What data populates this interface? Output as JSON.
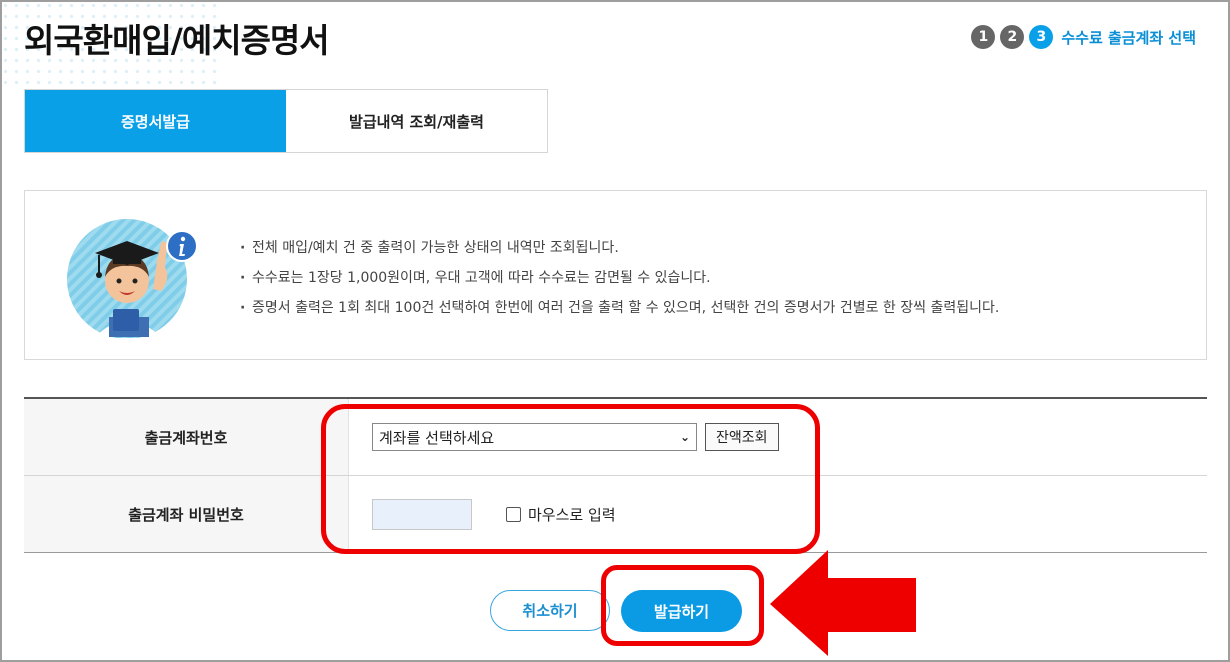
{
  "page": {
    "title": "외국환매입/예치증명서"
  },
  "steps": {
    "items": [
      "1",
      "2",
      "3"
    ],
    "current_label": "수수료 출금계좌 선택"
  },
  "tabs": [
    {
      "label": "증명서발급",
      "active": true
    },
    {
      "label": "발급내역 조회/재출력",
      "active": false
    }
  ],
  "notice": {
    "icon": "info-icon",
    "items": [
      "전체 매입/예치 건 중 출력이 가능한 상태의 내역만 조회됩니다.",
      "수수료는 1장당 1,000원이며, 우대 고객에 따라 수수료는 감면될 수 있습니다.",
      "증명서 출력은 1회 최대 100건 선택하여 한번에 여러 건을 출력 할 수 있으며, 선택한 건의 증명서가 건별로 한 장씩 출력됩니다."
    ]
  },
  "form": {
    "account_label": "출금계좌번호",
    "account_select_value": "계좌를 선택하세요",
    "balance_button": "잔액조회",
    "password_label": "출금계좌 비밀번호",
    "password_value": "",
    "mouse_input_label": "마우스로 입력"
  },
  "actions": {
    "cancel_label": "취소하기",
    "issue_label": "발급하기"
  },
  "colors": {
    "accent": "#0aa0e8",
    "highlight": "#ee0000",
    "step_inactive": "#666666"
  }
}
